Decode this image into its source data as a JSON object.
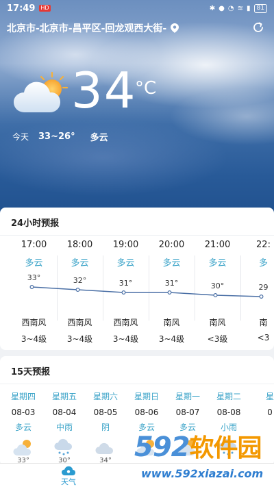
{
  "status_bar": {
    "time": "17:49",
    "notification": "HD",
    "battery": "81"
  },
  "location": {
    "text": "北京市-北京市-昌平区-回龙观西大街-"
  },
  "current": {
    "temp": "34",
    "unit": "°C",
    "today_label": "今天",
    "range": "33~26°",
    "condition": "多云"
  },
  "hourly": {
    "title": "24小时预报",
    "items": [
      {
        "time": "17:00",
        "cond": "多云",
        "temp": "33°",
        "temp_value": 33,
        "wind": "西南风",
        "level": "3~4级"
      },
      {
        "time": "18:00",
        "cond": "多云",
        "temp": "32°",
        "temp_value": 32,
        "wind": "西南风",
        "level": "3~4级"
      },
      {
        "time": "19:00",
        "cond": "多云",
        "temp": "31°",
        "temp_value": 31,
        "wind": "西南风",
        "level": "3~4级"
      },
      {
        "time": "20:00",
        "cond": "多云",
        "temp": "31°",
        "temp_value": 31,
        "wind": "南风",
        "level": "3~4级"
      },
      {
        "time": "21:00",
        "cond": "多云",
        "temp": "30°",
        "temp_value": 30,
        "wind": "南风",
        "level": "<3级"
      },
      {
        "time": "22:",
        "cond": "多",
        "temp": "29",
        "temp_value": 29.5,
        "wind": "南",
        "level": "<3"
      }
    ]
  },
  "daily": {
    "title": "15天预报",
    "items": [
      {
        "week": "星期四",
        "date": "08-03",
        "cond": "多云",
        "icon": "partly-cloudy-icon",
        "temp": "33°"
      },
      {
        "week": "星期五",
        "date": "08-04",
        "cond": "中雨",
        "icon": "rain-icon",
        "temp": "30°"
      },
      {
        "week": "星期六",
        "date": "08-05",
        "cond": "阴",
        "icon": "cloud-icon",
        "temp": "34°"
      },
      {
        "week": "星期日",
        "date": "08-06",
        "cond": "多云",
        "icon": "partly-cloudy-icon",
        "temp": ""
      },
      {
        "week": "星期一",
        "date": "08-07",
        "cond": "多云",
        "icon": "partly-cloudy-icon",
        "temp": ""
      },
      {
        "week": "星期二",
        "date": "08-08",
        "cond": "小雨",
        "icon": "rain-icon",
        "temp": ""
      },
      {
        "week": "星",
        "date": "0",
        "cond": "",
        "icon": "",
        "temp": ""
      }
    ]
  },
  "nav": {
    "weather_label": "天气"
  },
  "watermark": {
    "brand_num": "592",
    "brand_cn": "软件园",
    "url": "www.592xiazai.com"
  },
  "colors": {
    "accent": "#3aa3c8",
    "line": "#4a6fa5"
  }
}
